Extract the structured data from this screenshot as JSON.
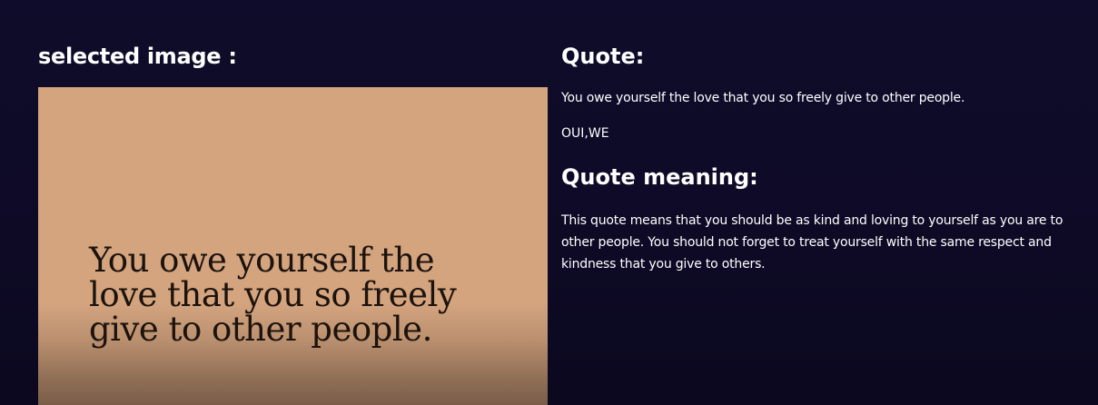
{
  "left": {
    "heading": "selected image :",
    "image_quote": "You owe yourself the love that you so freely give to other people.",
    "image_bg": "#d4a47f"
  },
  "right": {
    "quote_heading": "Quote:",
    "quote_text": "You owe yourself the love that you so freely give to other people.",
    "author": "OUI,WE",
    "meaning_heading": "Quote meaning:",
    "meaning_text": "This quote means that you should be as kind and loving to yourself as you are to other people. You should not forget to treat yourself with the same respect and kindness that you give to others."
  },
  "colors": {
    "background": "#0e0b28",
    "text": "#ffffff"
  }
}
